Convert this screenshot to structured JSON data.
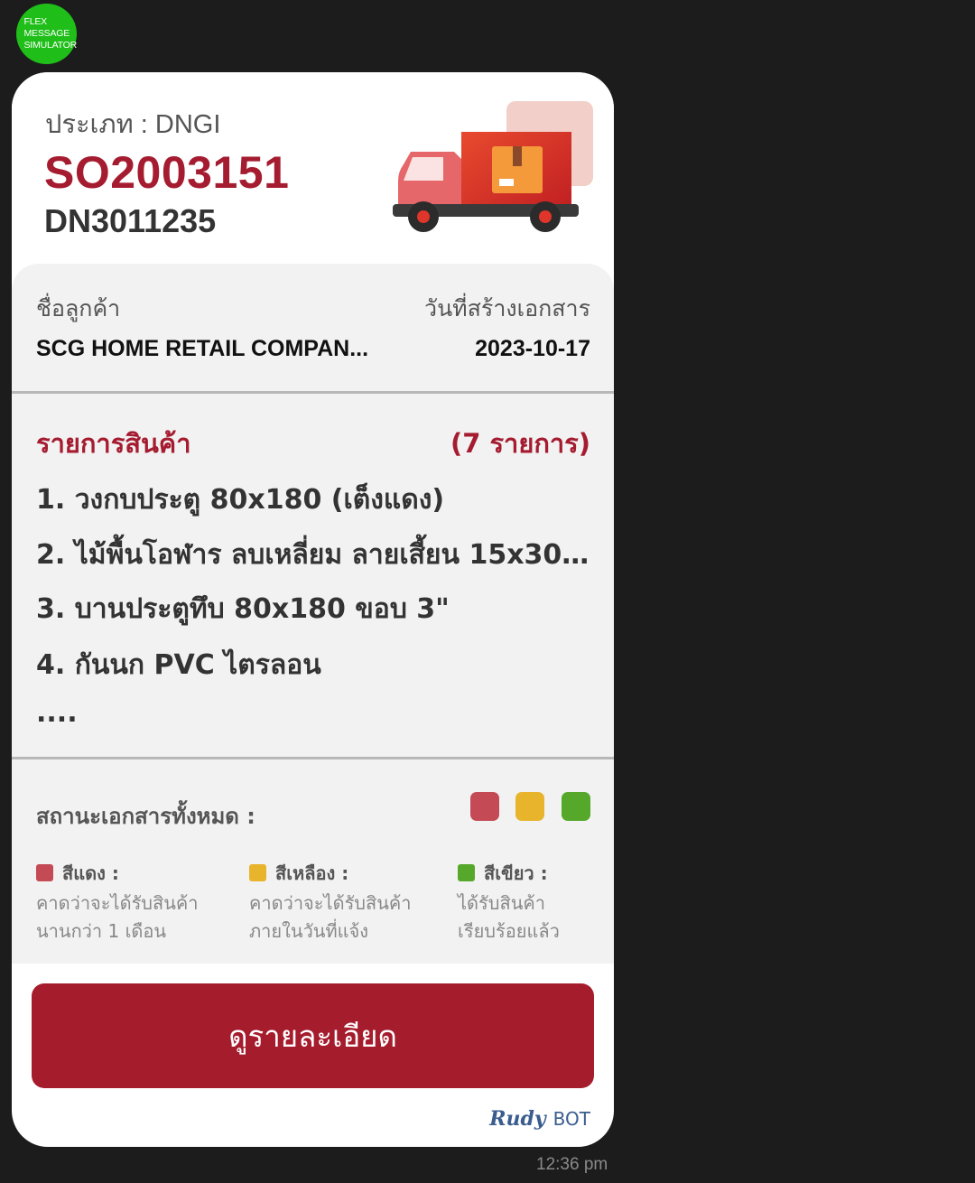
{
  "avatar": {
    "lines": [
      "FLEX",
      "MESSAGE",
      "SIMULATOR"
    ]
  },
  "header": {
    "type_label": "ประเภท : DNGI",
    "so_number": "SO2003151",
    "dn_number": "DN3011235"
  },
  "customer": {
    "name_label": "ชื่อลูกค้า",
    "name_value": "SCG HOME RETAIL COMPAN...",
    "date_label": "วันที่สร้างเอกสาร",
    "date_value": "2023-10-17"
  },
  "items": {
    "title": "รายการสินค้า",
    "count": "(7 รายการ)",
    "list": [
      "1. วงกบประตู 80x180 (เต็งแดง)",
      "2. ไม้พื้นโอฬาร ลบเหลี่ยม ลายเสี้ยน 15x300...",
      "3. บานประตูทึบ 80x180 ขอบ 3\"",
      "4. กันนก PVC ไตรลอน",
      "...."
    ]
  },
  "status": {
    "title": "สถานะเอกสารทั้งหมด :",
    "dots": [
      "#c44a55",
      "#e8b42c",
      "#55a82a"
    ],
    "legend": [
      {
        "name": "สีแดง :",
        "desc": [
          "คาดว่าจะได้รับสินค้า",
          "นานกว่า 1 เดือน"
        ],
        "color": "#c44a55"
      },
      {
        "name": "สีเหลือง :",
        "desc": [
          "คาดว่าจะได้รับสินค้า",
          "ภายในวันที่แจ้ง"
        ],
        "color": "#e8b42c"
      },
      {
        "name": "สีเขียว :",
        "desc": [
          "ได้รับสินค้า",
          "เรียบร้อยแล้ว"
        ],
        "color": "#55a82a"
      }
    ]
  },
  "button": {
    "label": "ดูรายละเอียด"
  },
  "brand": {
    "script": "Rudy",
    "suffix": "BOT"
  },
  "timestamp": "12:36 pm",
  "colors": {
    "accent": "#a51c30",
    "background": "#1c1c1c"
  }
}
